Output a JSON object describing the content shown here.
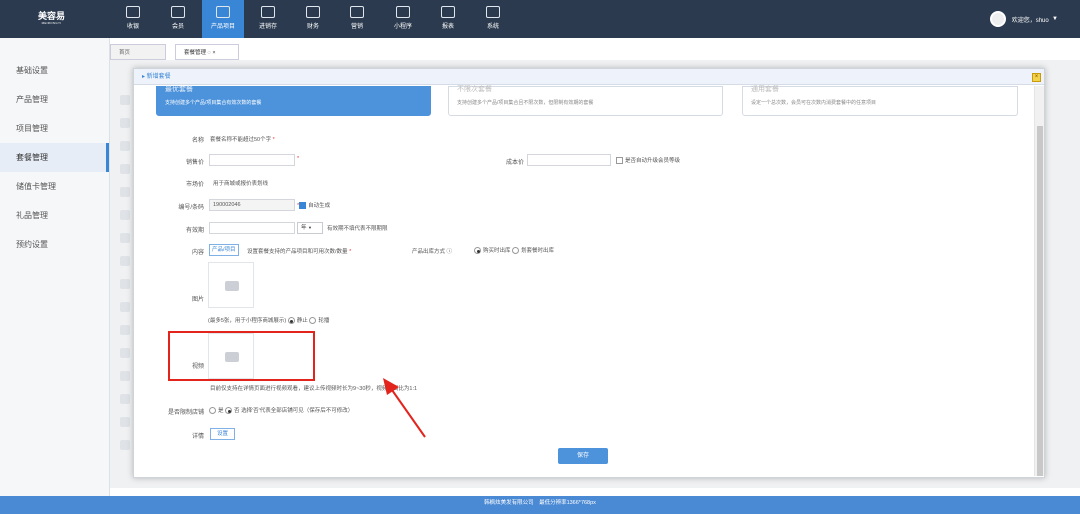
{
  "brand": {
    "name": "美容易",
    "sub": "MEIRONGYI"
  },
  "nav": [
    {
      "label": "收银",
      "icon": "cashier-icon"
    },
    {
      "label": "会员",
      "icon": "member-icon"
    },
    {
      "label": "产品项目",
      "icon": "product-icon"
    },
    {
      "label": "进销存",
      "icon": "inventory-icon"
    },
    {
      "label": "财务",
      "icon": "finance-icon"
    },
    {
      "label": "营销",
      "icon": "marketing-icon"
    },
    {
      "label": "小程序",
      "icon": "miniapp-icon"
    },
    {
      "label": "报表",
      "icon": "report-icon"
    },
    {
      "label": "系统",
      "icon": "system-icon"
    }
  ],
  "user": {
    "greeting": "欢迎您，shuo",
    "caret": "▼"
  },
  "sidebar": [
    "基础设置",
    "产品管理",
    "项目管理",
    "套餐管理",
    "储值卡管理",
    "礼品管理",
    "预约设置"
  ],
  "tabs": [
    {
      "label": "首页"
    },
    {
      "label": "套餐管理 ◌ ×"
    }
  ],
  "modal": {
    "title": "▸ 新增套餐",
    "close": "×",
    "cards": [
      {
        "title": "最优套餐",
        "desc": "支持创建多个产品/项目集合有效次数的套餐"
      },
      {
        "title": "不限次套餐",
        "desc": "支持创建多个产品/项目集合且不限次数，但限制有效期的套餐"
      },
      {
        "title": "通用套餐",
        "desc": "设定一个总次数，会员可在次数内消费套餐中的任意项目"
      }
    ],
    "fields": {
      "name_label": "名称",
      "name_placeholder": "套餐名称不能超过50个字",
      "sale_label": "销售价",
      "cost_label": "成本价",
      "auto_upgrade": "是否自动升级会员等级",
      "market_label": "市场价",
      "market_placeholder": "用于商城或报价表划线",
      "code_label": "编号/条码",
      "code_value": "190002046",
      "auto_gen": "自动生成",
      "valid_label": "有效期",
      "valid_unit": "年",
      "valid_hint": "有效期不填代表不限期限",
      "content_label": "内容",
      "content_btn": "产品/项目",
      "content_hint": "设置套餐支持的产品项目和可用次数/数量",
      "out_label": "产品出库方式",
      "out_opt1": "购买时出库",
      "out_opt2": "划套餐时出库",
      "image_label": "图片",
      "image_hint": "(最多5张，用于小程序商城展示)",
      "image_opt1": "静止",
      "image_opt2": "轮播",
      "video_label": "视频",
      "video_hint": "目前仅支持在详情页面进行视频观看，建议上传视频时长为9~30秒，视频宽高比为1:1",
      "limit_label": "是否限制店铺",
      "limit_yes": "是",
      "limit_no": "否",
      "limit_hint": "选择'否'代表全部店铺可见（保存后不可修改）",
      "detail_label": "详情",
      "detail_btn": "设置"
    },
    "save": "保存",
    "required": "*"
  },
  "footer": "韩枫炫美发有限公司　最低分辨率1366*768px",
  "colors": {
    "header": "#2b3a4e",
    "accent": "#3a86d6",
    "annotation": "#e2241d"
  }
}
